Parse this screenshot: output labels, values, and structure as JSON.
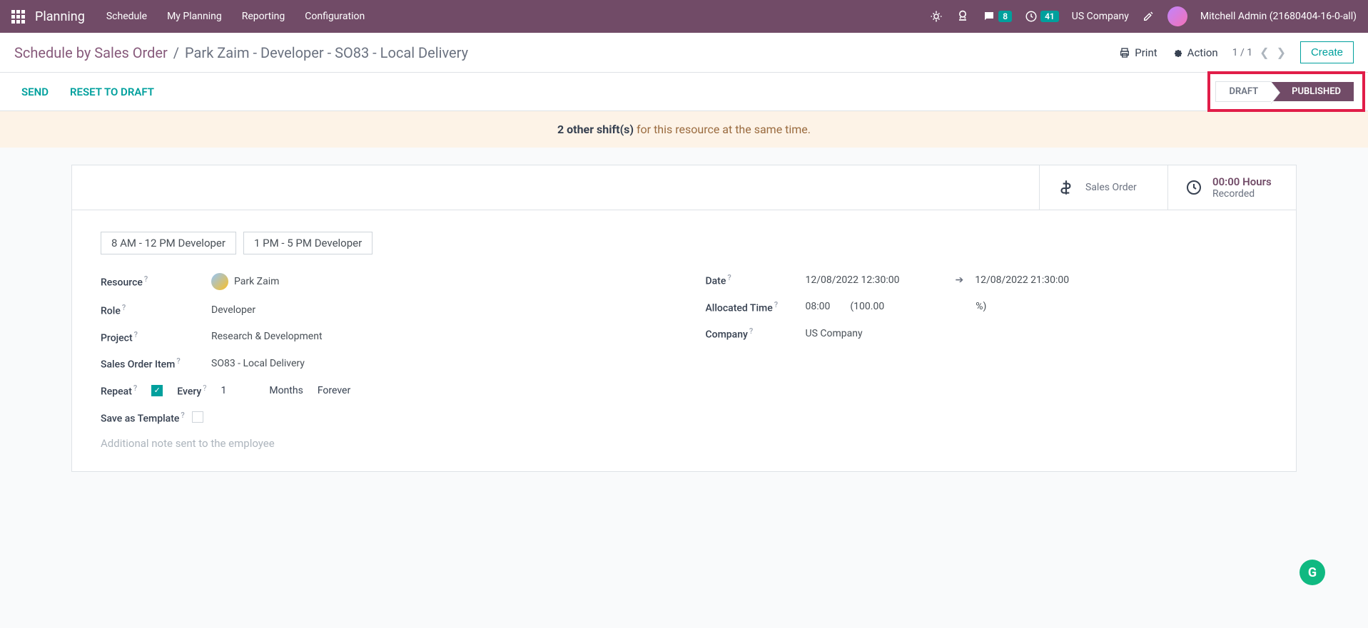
{
  "topbar": {
    "app": "Planning",
    "nav": [
      "Schedule",
      "My Planning",
      "Reporting",
      "Configuration"
    ],
    "messages_count": "8",
    "activities_count": "41",
    "company": "US Company",
    "user": "Mitchell Admin (21680404-16-0-all)"
  },
  "breadcrumb": {
    "root": "Schedule by Sales Order",
    "current": "Park Zaim - Developer - SO83 - Local Delivery"
  },
  "header_actions": {
    "print": "Print",
    "action": "Action",
    "pager": "1 / 1",
    "create": "Create"
  },
  "status_actions": {
    "send": "SEND",
    "reset": "RESET TO DRAFT",
    "draft": "DRAFT",
    "published": "PUBLISHED"
  },
  "alert": {
    "bold": "2 other shift(s)",
    "text": " for this resource at the same time."
  },
  "stats": {
    "sales_order": "Sales Order",
    "hours_top": "00:00 Hours",
    "hours_bottom": "Recorded"
  },
  "tags": [
    "8 AM - 12 PM Developer",
    "1 PM - 5 PM Developer"
  ],
  "fields": {
    "resource_label": "Resource",
    "resource_value": "Park Zaim",
    "role_label": "Role",
    "role_value": "Developer",
    "project_label": "Project",
    "project_value": "Research & Development",
    "soitem_label": "Sales Order Item",
    "soitem_value": "SO83 - Local Delivery",
    "date_label": "Date",
    "date_from": "12/08/2022 12:30:00",
    "date_to": "12/08/2022 21:30:00",
    "alloc_label": "Allocated Time",
    "alloc_hours": "08:00",
    "alloc_pct_open": "(100.00",
    "alloc_pct_close": "%)",
    "company_label": "Company",
    "company_value": "US Company",
    "repeat_label": "Repeat",
    "every_label": "Every",
    "every_value": "1",
    "every_unit": "Months",
    "every_end": "Forever",
    "template_label": "Save as Template",
    "note_placeholder": "Additional note sent to the employee"
  },
  "fab": "G"
}
